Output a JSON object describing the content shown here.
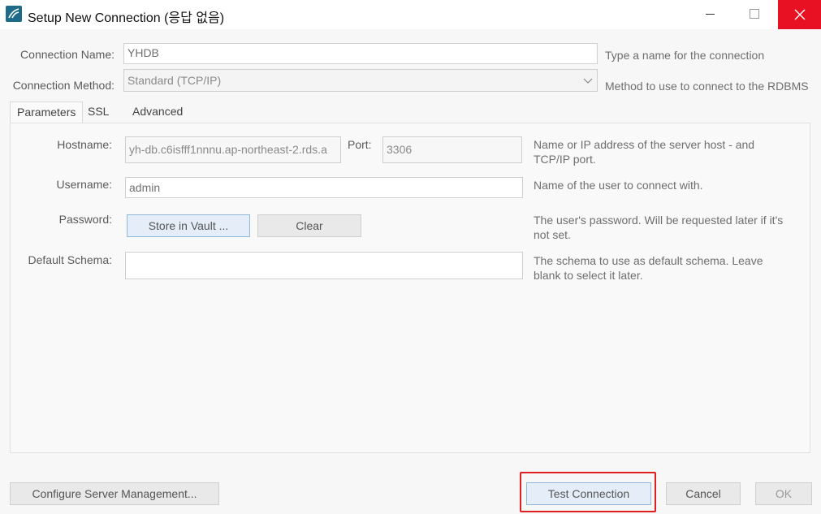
{
  "window": {
    "title": "Setup New Connection (응답 없음)"
  },
  "connection_name": {
    "label": "Connection Name:",
    "value": "YHDB",
    "hint": "Type a name for the connection"
  },
  "connection_method": {
    "label": "Connection Method:",
    "value": "Standard (TCP/IP)",
    "hint": "Method to use to connect to the RDBMS"
  },
  "tabs": [
    {
      "label": "Parameters"
    },
    {
      "label": "SSL"
    },
    {
      "label": "Advanced"
    }
  ],
  "params": {
    "hostname_label": "Hostname:",
    "hostname_value": "yh-db.c6isfff1nnnu.ap-northeast-2.rds.a",
    "port_label": "Port:",
    "port_value": "3306",
    "hostname_hint_1": "Name or IP address of the server host - and",
    "hostname_hint_2": "TCP/IP port.",
    "username_label": "Username:",
    "username_value": "admin",
    "username_hint": "Name of the user to connect with.",
    "password_label": "Password:",
    "store_vault_label": "Store in Vault ...",
    "clear_label": "Clear",
    "password_hint_1": "The user's password. Will be requested later if it's",
    "password_hint_2": "not set.",
    "schema_label": "Default Schema:",
    "schema_value": "",
    "schema_hint_1": "The schema to use as default schema. Leave",
    "schema_hint_2": "blank to select it later."
  },
  "footer": {
    "configure_label": "Configure Server Management...",
    "test_label": "Test Connection",
    "cancel_label": "Cancel",
    "ok_label": "OK"
  },
  "colors": {
    "close_button": "#e81123",
    "highlight_box": "#e02020"
  }
}
